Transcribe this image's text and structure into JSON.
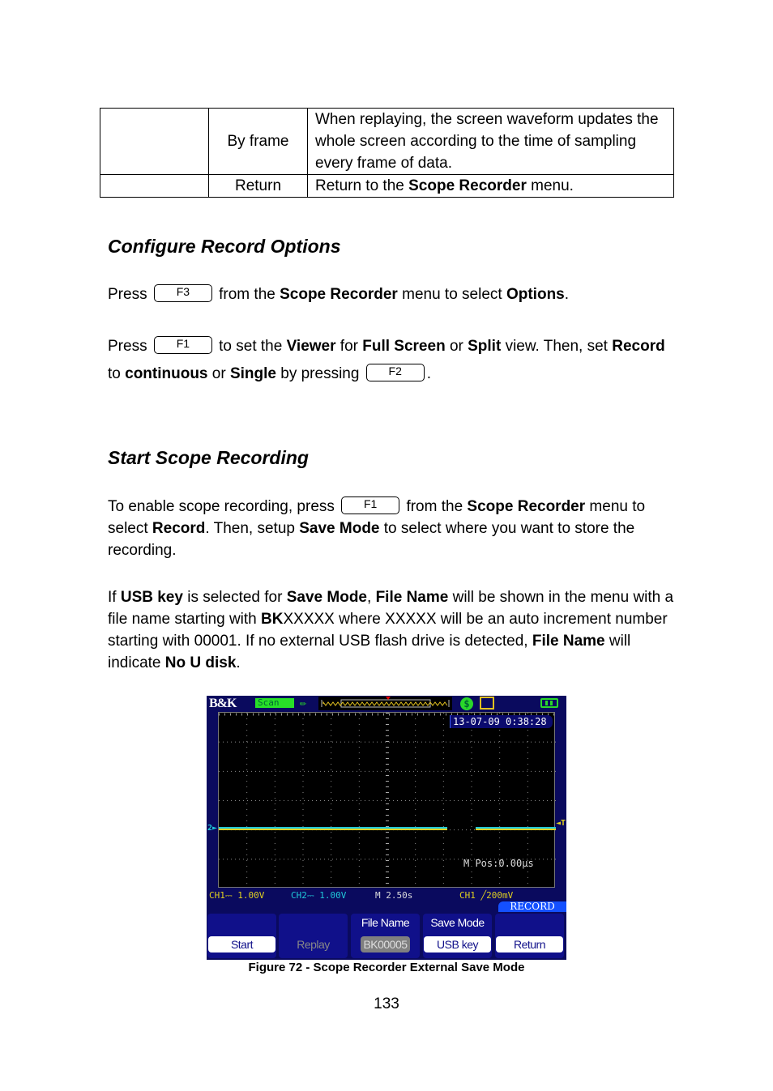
{
  "table": {
    "rows": [
      {
        "col1": "",
        "col2": "By frame",
        "col3": "When replaying, the screen waveform updates the whole screen according to the time of sampling every frame of data."
      },
      {
        "col1": "",
        "col2": "Return",
        "col3_pre": "Return to the ",
        "col3_bold": "Scope Recorder",
        "col3_post": " menu."
      }
    ]
  },
  "section1": {
    "heading": "Configure Record Options",
    "p1": {
      "t1": "Press",
      "key": "F3",
      "t2": " from the ",
      "b1": "Scope Recorder",
      "t3": " menu to select ",
      "b2": "Options",
      "t4": "."
    },
    "p2": {
      "t1": "Press",
      "key1": "F1",
      "t2": " to set the ",
      "b1": "Viewer",
      "t3": " for ",
      "b2": "Full Screen",
      "t4": " or ",
      "b3": "Split",
      "t5": " view.  Then, set ",
      "b4": "Record",
      "t6": " to ",
      "b5": "continuous",
      "t7": " or ",
      "b6": "Single",
      "t8": " by pressing ",
      "key2": "F2",
      "t9": "."
    }
  },
  "section2": {
    "heading": "Start Scope Recording",
    "p1": {
      "t1": "To enable scope recording, press ",
      "key": "F1",
      "t2": " from the ",
      "b1": "Scope Recorder",
      "t3": " menu to select ",
      "b2": "Record",
      "t4": ".  Then, setup ",
      "b3": "Save Mode",
      "t5": " to select where you want to store the recording."
    },
    "p2": {
      "t1": "If ",
      "b1": "USB key",
      "t2": " is selected for ",
      "b2": "Save Mode",
      "t3": ", ",
      "b3": "File Name",
      "t4": " will be shown in the menu with a file name starting with ",
      "b4": "BK",
      "t5": "XXXXX where XXXXX will be an auto increment number starting with 00001.  If no external USB flash drive is detected, ",
      "b5": "File Name",
      "t6": " will indicate ",
      "b6": "No U disk",
      "t7": "."
    }
  },
  "scope": {
    "logo": "B&K",
    "mode": "Scan",
    "timestamp": "13-07-09 0:38:28",
    "mpos": "M Pos:0.00µs",
    "ch2_marker": "2",
    "trigger_marker": "T",
    "status": {
      "ch1": "CH1⎓ 1.00V",
      "ch2": "CH2⎓ 1.00V",
      "timebase": "M 2.50s",
      "trigger": "CH1 ╱200mV"
    },
    "menu_title": "RECORD",
    "menu": [
      {
        "label": "",
        "value": "Start",
        "state": "normal"
      },
      {
        "label": "",
        "value": "Replay",
        "state": "dim"
      },
      {
        "label": "File Name",
        "value": "BK00005",
        "state": "disabled"
      },
      {
        "label": "Save Mode",
        "value": "USB key",
        "state": "normal"
      },
      {
        "label": "",
        "value": "Return",
        "state": "normal"
      }
    ],
    "colors": {
      "ch1": "#e0d020",
      "ch2": "#20c8d8",
      "background": "#0a0a5e",
      "menu_accent": "#1450ff"
    }
  },
  "figure_caption": "Figure 72 - Scope Recorder External Save Mode",
  "page_number": "133"
}
